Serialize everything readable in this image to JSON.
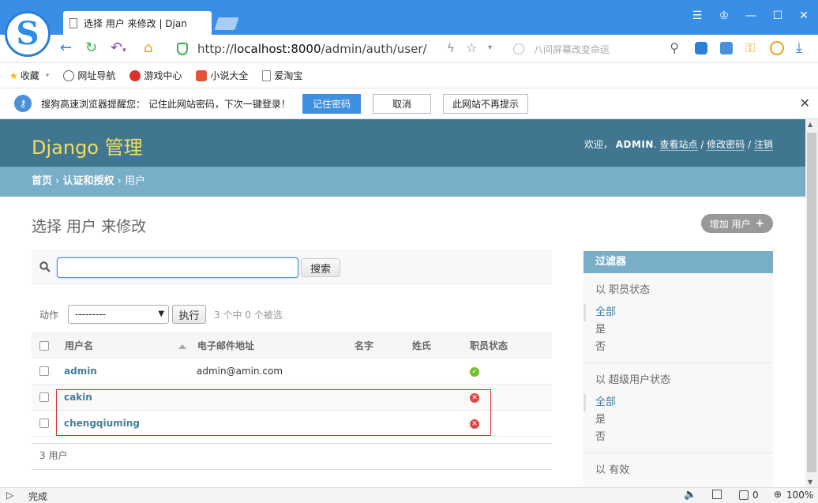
{
  "browser": {
    "tab_title": "选择 用户 来修改 | Djan",
    "url_scheme": "http://",
    "url_host": "localhost:8000",
    "url_path": "/admin/auth/user/",
    "search_placeholder": "八间屏幕改变命运",
    "bookmarks": [
      "收藏",
      "网址导航",
      "游戏中心",
      "小说大全",
      "爱淘宝"
    ],
    "info_text": "搜狗高速浏览器提醒您：  记住此网站密码，下次一键登录！",
    "info_buttons": [
      "记住密码",
      "取消",
      "此网站不再提示"
    ],
    "status_text": "完成",
    "zoom": "100%",
    "download_count": "0"
  },
  "header": {
    "brand": "Django 管理",
    "welcome": "欢迎，",
    "username": "ADMIN",
    "view_site": "查看站点",
    "change_password": "修改密码",
    "logout": "注销",
    "sep": "/"
  },
  "breadcrumbs": {
    "home": "首页",
    "app": "认证和授权",
    "current": "用户",
    "sep": "›"
  },
  "main": {
    "title": "选择 用户 来修改",
    "add_button": "增加 用户",
    "search_button": "搜索",
    "action_label": "动作",
    "action_selected": "---------",
    "action_go": "执行",
    "action_counter": "3 个中 0 个被选",
    "columns": [
      "用户名",
      "电子邮件地址",
      "名字",
      "姓氏",
      "职员状态"
    ],
    "rows": [
      {
        "username": "admin",
        "email": "admin@amin.com",
        "first_name": "",
        "last_name": "",
        "staff": true
      },
      {
        "username": "cakin",
        "email": "",
        "first_name": "",
        "last_name": "",
        "staff": false
      },
      {
        "username": "chengqiuming",
        "email": "",
        "first_name": "",
        "last_name": "",
        "staff": false
      }
    ],
    "result_count": "3 用户"
  },
  "filter": {
    "title": "过滤器",
    "sections": [
      {
        "title": "以 职员状态",
        "items": [
          "全部",
          "是",
          "否"
        ]
      },
      {
        "title": "以 超级用户状态",
        "items": [
          "全部",
          "是",
          "否"
        ]
      },
      {
        "title": "以 有效",
        "items": []
      }
    ]
  },
  "colors": {
    "header_bg": "#417690",
    "brand": "#f5dd5d",
    "breadcrumb_bg": "#79aec8",
    "link": "#447e9b",
    "staff_yes": "#70bf2b",
    "staff_no": "#dd4646",
    "highlight_box": "#dd3333"
  }
}
